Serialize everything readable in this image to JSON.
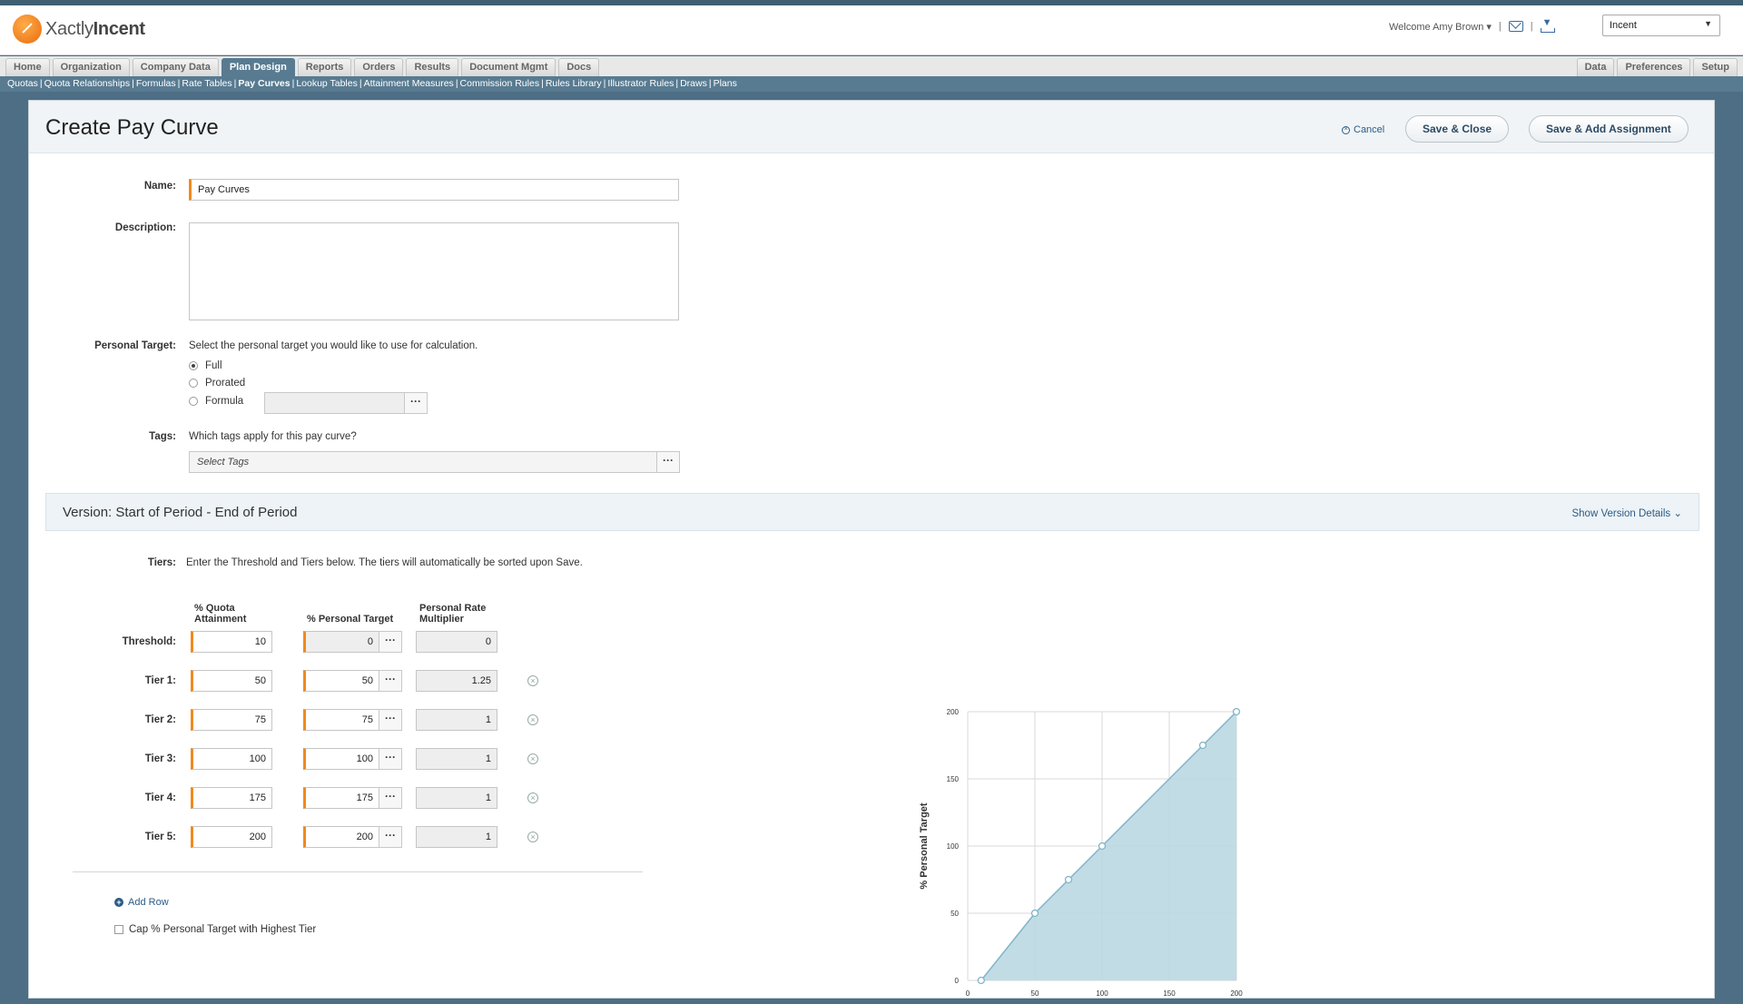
{
  "header": {
    "logo_prefix": "Xactly",
    "logo_suffix": "Incent",
    "welcome": "Welcome Amy Brown ▾",
    "app_select": "Incent"
  },
  "nav": {
    "tabs": [
      "Home",
      "Organization",
      "Company Data",
      "Plan Design",
      "Reports",
      "Orders",
      "Results",
      "Document Mgmt",
      "Docs"
    ],
    "active_tab": "Plan Design",
    "right_tabs": [
      "Data",
      "Preferences",
      "Setup"
    ],
    "subnav": [
      "Quotas",
      "Quota Relationships",
      "Formulas",
      "Rate Tables",
      "Pay Curves",
      "Lookup Tables",
      "Attainment Measures",
      "Commission Rules",
      "Rules Library",
      "Illustrator Rules",
      "Draws",
      "Plans"
    ],
    "active_subnav": "Pay Curves"
  },
  "page": {
    "title": "Create Pay Curve",
    "cancel_label": "Cancel",
    "save_close_label": "Save & Close",
    "save_add_label": "Save & Add Assignment"
  },
  "form": {
    "name_label": "Name:",
    "name_value": "Pay Curves",
    "description_label": "Description:",
    "personal_target_label": "Personal Target:",
    "personal_target_hint": "Select the personal target you would like to use for calculation.",
    "options": [
      "Full",
      "Prorated",
      "Formula"
    ],
    "selected_option": "Full",
    "tags_label": "Tags:",
    "tags_hint": "Which tags apply for this pay curve?",
    "tags_placeholder": "Select Tags"
  },
  "version": {
    "title": "Version: Start of Period - End of Period",
    "show_details": "Show Version Details",
    "tiers_label": "Tiers:",
    "tiers_hint": "Enter the Threshold and Tiers below. The tiers will automatically be sorted upon Save.",
    "col_quota": "% Quota Attainment",
    "col_target": "% Personal Target",
    "col_multiplier": "Personal Rate Multiplier",
    "rows": [
      {
        "label": "Threshold:",
        "quota": "10",
        "target": "0",
        "multiplier": "0"
      },
      {
        "label": "Tier 1:",
        "quota": "50",
        "target": "50",
        "multiplier": "1.25"
      },
      {
        "label": "Tier 2:",
        "quota": "75",
        "target": "75",
        "multiplier": "1"
      },
      {
        "label": "Tier 3:",
        "quota": "100",
        "target": "100",
        "multiplier": "1"
      },
      {
        "label": "Tier 4:",
        "quota": "175",
        "target": "175",
        "multiplier": "1"
      },
      {
        "label": "Tier 5:",
        "quota": "200",
        "target": "200",
        "multiplier": "1"
      }
    ],
    "add_row_label": "Add Row",
    "cap_label": "Cap % Personal Target with Highest Tier"
  },
  "chart_data": {
    "type": "area",
    "x": [
      10,
      50,
      75,
      100,
      175,
      200
    ],
    "y": [
      0,
      50,
      75,
      100,
      175,
      200
    ],
    "xlabel": "% Quota Attainment",
    "ylabel": "% Personal Target",
    "xlim": [
      0,
      200
    ],
    "ylim": [
      0,
      200
    ],
    "xticks": [
      0,
      50,
      100,
      150,
      200
    ],
    "yticks": [
      0,
      50,
      100,
      150,
      200
    ],
    "grid": true,
    "fill_color": "#b7d6e0",
    "line_color": "#7fb5c8"
  }
}
